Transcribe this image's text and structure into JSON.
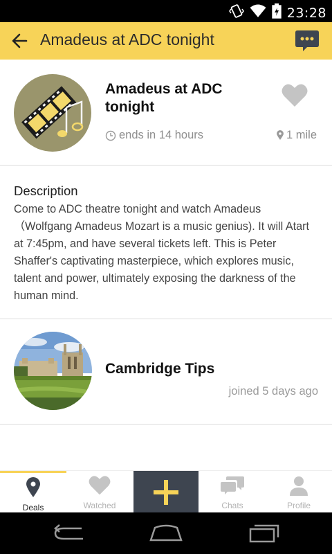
{
  "status_bar": {
    "time": "23:28"
  },
  "app_bar": {
    "title": "Amadeus at ADC tonight"
  },
  "event": {
    "title": "Amadeus at ADC tonight",
    "time_left": "ends in 14 hours",
    "distance": "1 mile"
  },
  "description": {
    "heading": "Description",
    "body": "Come to ADC theatre tonight and watch Amadeus （Wolfgang Amadeus Mozart is a music genius). It will Atart at 7:45pm, and have several tickets left. This is Peter Shaffer's captivating masterpiece, which explores music, talent and power, ultimately exposing the darkness of the human mind."
  },
  "organizer": {
    "name": "Cambridge Tips",
    "joined": "joined 5 days ago"
  },
  "tabs": [
    {
      "label": "Deals",
      "icon": "location-pin-icon",
      "active": true
    },
    {
      "label": "Watched",
      "icon": "heart-icon",
      "active": false
    },
    {
      "label": "Chats",
      "icon": "chat-bubbles-icon",
      "active": false
    },
    {
      "label": "Profile",
      "icon": "person-icon",
      "active": false
    }
  ],
  "colors": {
    "accent": "#f7d358",
    "add_button_bg": "#3e4550",
    "avatar_bg": "#9a956c"
  }
}
